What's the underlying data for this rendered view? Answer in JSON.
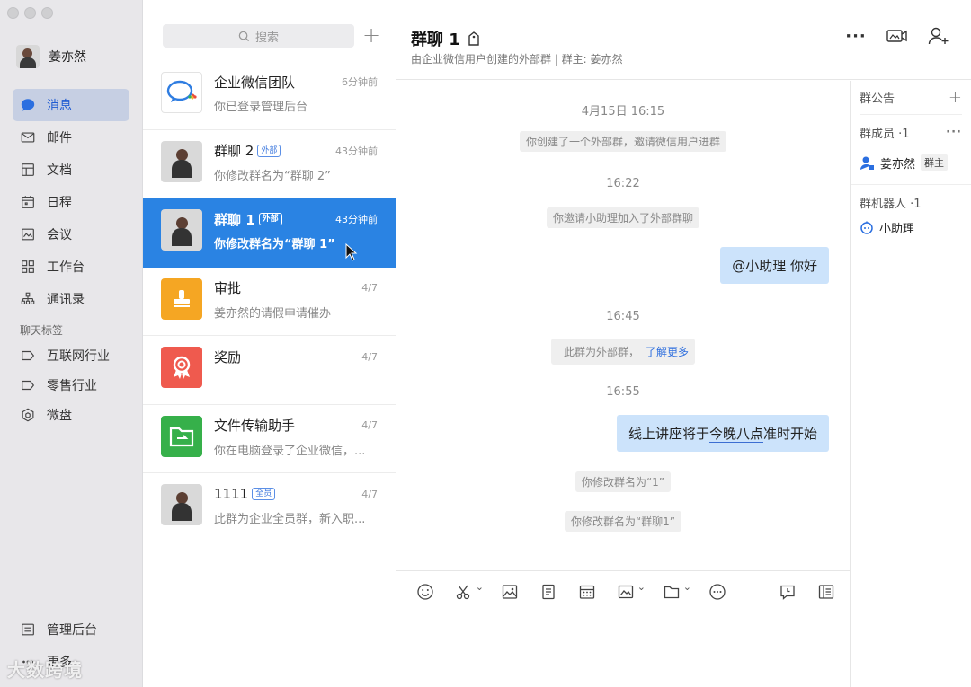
{
  "user": {
    "name": "姜亦然"
  },
  "nav": {
    "items": [
      {
        "label": "消息",
        "icon": "message-icon",
        "active": true
      },
      {
        "label": "邮件",
        "icon": "mail-icon"
      },
      {
        "label": "文档",
        "icon": "document-icon"
      },
      {
        "label": "日程",
        "icon": "calendar-icon"
      },
      {
        "label": "会议",
        "icon": "meeting-icon"
      },
      {
        "label": "工作台",
        "icon": "workbench-icon"
      },
      {
        "label": "通讯录",
        "icon": "contacts-icon"
      }
    ],
    "tags_header": "聊天标签",
    "tags": [
      {
        "label": "互联网行业"
      },
      {
        "label": "零售行业"
      },
      {
        "label": "微盘"
      }
    ],
    "bottom": [
      {
        "label": "管理后台"
      },
      {
        "label": "更多"
      }
    ]
  },
  "watermark": "大数跨境",
  "search": {
    "placeholder": "搜索"
  },
  "conversations": [
    {
      "title": "企业微信团队",
      "time": "6分钟前",
      "preview": "你已登录管理后台",
      "badge": ""
    },
    {
      "title": "群聊 2",
      "time": "43分钟前",
      "preview": "你修改群名为“群聊 2”",
      "badge": "外部"
    },
    {
      "title": "群聊 1",
      "time": "43分钟前",
      "preview": "你修改群名为“群聊 1”",
      "badge": "外部",
      "selected": true
    },
    {
      "title": "审批",
      "time": "4/7",
      "preview": "姜亦然的请假申请催办",
      "badge": ""
    },
    {
      "title": "奖励",
      "time": "4/7",
      "preview": "",
      "badge": ""
    },
    {
      "title": "文件传输助手",
      "time": "4/7",
      "preview": "你在电脑登录了企业微信，...",
      "badge": ""
    },
    {
      "title": "1111",
      "time": "4/7",
      "preview": "此群为企业全员群，新入职...",
      "badge": "全员"
    }
  ],
  "chat": {
    "title": "群聊 1",
    "subtitle": "由企业微信用户创建的外部群 | 群主: 姜亦然",
    "messages": {
      "ts1": "4月15日 16:15",
      "sys1": "你创建了一个外部群，邀请微信用户进群",
      "ts2": "16:22",
      "sys2": "你邀请小助理加入了外部群聊",
      "bubble1": "@小助理 你好",
      "ts3": "16:45",
      "sys3_text": "此群为外部群，",
      "sys3_link": "了解更多",
      "ts4": "16:55",
      "bubble2_a": "线上讲座将于",
      "bubble2_b": "今晚八点",
      "bubble2_c": "准时开始",
      "sys4": "你修改群名为“1”",
      "sys5": "你修改群名为“群聊1”"
    }
  },
  "info": {
    "notice": "群公告",
    "members_header": "群成员 ·1",
    "member_name": "姜亦然",
    "owner_tag": "群主",
    "robots_header": "群机器人 ·1",
    "robot_name": "小助理"
  },
  "colors": {
    "accent": "#2a83e3",
    "bubble": "#cce3fb",
    "sidebar": "#e8e7ea"
  }
}
